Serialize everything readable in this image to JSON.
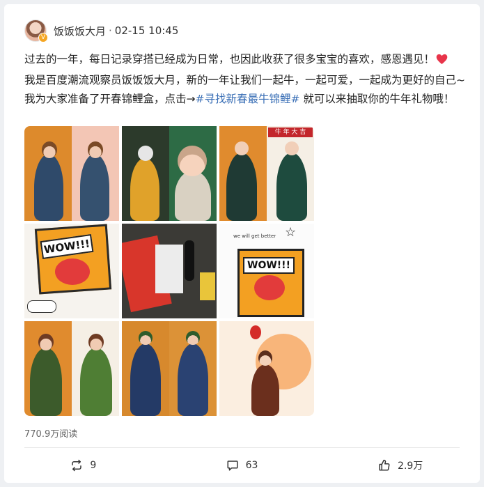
{
  "header": {
    "username": "饭饭饭大月",
    "separator": "·",
    "timestamp": "02-15 10:45",
    "badge": "V"
  },
  "post": {
    "text_before": "过去的一年，每日记录穿搭已经成为日常，也因此收获了很多宝宝的喜欢，感恩遇见！",
    "text_middle": "我是百度潮流观察员饭饭饭大月，新的一年让我们一起牛，一起可爱，一起成为更好的自己~我为大家准备了开春锦鲤盒，点击→",
    "hashtag": "#寻找新春最牛锦鲤#",
    "text_after": " 就可以来抽取你的牛年礼物哦！"
  },
  "images": {
    "wow_text_1": "WOW!!!",
    "wow_text_2": "WOW!!!",
    "wow_caption": "we will get better",
    "banner_text": "牛 年 大 吉"
  },
  "stats": {
    "reads": "770.9万阅读"
  },
  "actions": {
    "repost_count": "9",
    "comment_count": "63",
    "like_count": "2.9万"
  },
  "colors": {
    "accent": "#3a6fb6",
    "heart": "#e8344a",
    "vbadge": "#f5a623"
  }
}
